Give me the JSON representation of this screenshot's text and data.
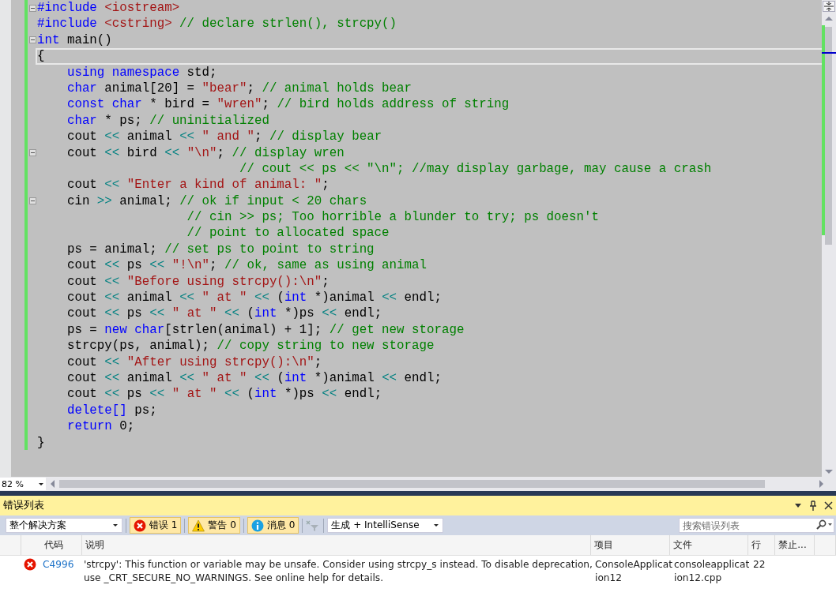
{
  "editor": {
    "lines": [
      {
        "fold": true,
        "current": false,
        "tokens": [
          {
            "kind": "keyword",
            "text": "#include"
          },
          {
            "kind": "string",
            "text": " <iostream>"
          }
        ]
      },
      {
        "fold": false,
        "current": false,
        "tokens": [
          {
            "kind": "keyword",
            "text": "#include"
          },
          {
            "kind": "string",
            "text": " <cstring>"
          },
          {
            "kind": "comment",
            "text": " // declare strlen(), strcpy()"
          }
        ]
      },
      {
        "fold": true,
        "current": false,
        "tokens": [
          {
            "kind": "keyword",
            "text": "int"
          },
          {
            "kind": "plain",
            "text": " main()"
          }
        ]
      },
      {
        "fold": false,
        "current": true,
        "tokens": [
          {
            "kind": "plain",
            "text": "{"
          }
        ]
      },
      {
        "fold": false,
        "current": false,
        "tokens": [
          {
            "kind": "keyword",
            "text": "    using namespace"
          },
          {
            "kind": "plain",
            "text": " std;"
          }
        ]
      },
      {
        "fold": false,
        "current": false,
        "tokens": [
          {
            "kind": "keyword",
            "text": "    char"
          },
          {
            "kind": "plain",
            "text": " animal[20] = "
          },
          {
            "kind": "string",
            "text": "\"bear\""
          },
          {
            "kind": "plain",
            "text": "; "
          },
          {
            "kind": "comment",
            "text": "// animal holds bear"
          }
        ]
      },
      {
        "fold": false,
        "current": false,
        "tokens": [
          {
            "kind": "keyword",
            "text": "    const char"
          },
          {
            "kind": "plain",
            "text": " * bird = "
          },
          {
            "kind": "string",
            "text": "\"wren\""
          },
          {
            "kind": "plain",
            "text": "; "
          },
          {
            "kind": "comment",
            "text": "// bird holds address of string"
          }
        ]
      },
      {
        "fold": false,
        "current": false,
        "tokens": [
          {
            "kind": "keyword",
            "text": "    char"
          },
          {
            "kind": "plain",
            "text": " * ps; "
          },
          {
            "kind": "comment",
            "text": "// uninitialized"
          }
        ]
      },
      {
        "fold": false,
        "current": false,
        "tokens": [
          {
            "kind": "plain",
            "text": "    cout "
          },
          {
            "kind": "operator",
            "text": "<<"
          },
          {
            "kind": "plain",
            "text": " animal "
          },
          {
            "kind": "operator",
            "text": "<<"
          },
          {
            "kind": "string",
            "text": " \" and \""
          },
          {
            "kind": "plain",
            "text": "; "
          },
          {
            "kind": "comment",
            "text": "// display bear"
          }
        ]
      },
      {
        "fold": true,
        "current": false,
        "tokens": [
          {
            "kind": "plain",
            "text": "    cout "
          },
          {
            "kind": "operator",
            "text": "<<"
          },
          {
            "kind": "plain",
            "text": " bird "
          },
          {
            "kind": "operator",
            "text": "<<"
          },
          {
            "kind": "string",
            "text": " \"\\n\""
          },
          {
            "kind": "plain",
            "text": "; "
          },
          {
            "kind": "comment",
            "text": "// display wren"
          }
        ]
      },
      {
        "fold": false,
        "current": false,
        "tokens": [
          {
            "kind": "comment",
            "text": "                           // cout << ps << \"\\n\"; //may display garbage, may cause a crash"
          }
        ]
      },
      {
        "fold": false,
        "current": false,
        "tokens": [
          {
            "kind": "plain",
            "text": "    cout "
          },
          {
            "kind": "operator",
            "text": "<<"
          },
          {
            "kind": "string",
            "text": " \"Enter a kind of animal: \""
          },
          {
            "kind": "plain",
            "text": ";"
          }
        ]
      },
      {
        "fold": true,
        "current": false,
        "tokens": [
          {
            "kind": "plain",
            "text": "    cin "
          },
          {
            "kind": "operator",
            "text": ">>"
          },
          {
            "kind": "plain",
            "text": " animal; "
          },
          {
            "kind": "comment",
            "text": "// ok if input < 20 chars"
          }
        ]
      },
      {
        "fold": false,
        "current": false,
        "tokens": [
          {
            "kind": "comment",
            "text": "                    // cin >> ps; Too horrible a blunder to try; ps doesn't"
          }
        ]
      },
      {
        "fold": false,
        "current": false,
        "tokens": [
          {
            "kind": "comment",
            "text": "                    // point to allocated space"
          }
        ]
      },
      {
        "fold": false,
        "current": false,
        "tokens": [
          {
            "kind": "plain",
            "text": "    ps = animal; "
          },
          {
            "kind": "comment",
            "text": "// set ps to point to string"
          }
        ]
      },
      {
        "fold": false,
        "current": false,
        "tokens": [
          {
            "kind": "plain",
            "text": "    cout "
          },
          {
            "kind": "operator",
            "text": "<<"
          },
          {
            "kind": "plain",
            "text": " ps "
          },
          {
            "kind": "operator",
            "text": "<<"
          },
          {
            "kind": "string",
            "text": " \"!\\n\""
          },
          {
            "kind": "plain",
            "text": "; "
          },
          {
            "kind": "comment",
            "text": "// ok, same as using animal"
          }
        ]
      },
      {
        "fold": false,
        "current": false,
        "tokens": [
          {
            "kind": "plain",
            "text": "    cout "
          },
          {
            "kind": "operator",
            "text": "<<"
          },
          {
            "kind": "string",
            "text": " \"Before using strcpy():\\n\""
          },
          {
            "kind": "plain",
            "text": ";"
          }
        ]
      },
      {
        "fold": false,
        "current": false,
        "tokens": [
          {
            "kind": "plain",
            "text": "    cout "
          },
          {
            "kind": "operator",
            "text": "<<"
          },
          {
            "kind": "plain",
            "text": " animal "
          },
          {
            "kind": "operator",
            "text": "<<"
          },
          {
            "kind": "string",
            "text": " \" at \""
          },
          {
            "kind": "operator",
            "text": " <<"
          },
          {
            "kind": "plain",
            "text": " ("
          },
          {
            "kind": "keyword",
            "text": "int"
          },
          {
            "kind": "plain",
            "text": " *)animal "
          },
          {
            "kind": "operator",
            "text": "<<"
          },
          {
            "kind": "plain",
            "text": " endl;"
          }
        ]
      },
      {
        "fold": false,
        "current": false,
        "tokens": [
          {
            "kind": "plain",
            "text": "    cout "
          },
          {
            "kind": "operator",
            "text": "<<"
          },
          {
            "kind": "plain",
            "text": " ps "
          },
          {
            "kind": "operator",
            "text": "<<"
          },
          {
            "kind": "string",
            "text": " \" at \""
          },
          {
            "kind": "operator",
            "text": " <<"
          },
          {
            "kind": "plain",
            "text": " ("
          },
          {
            "kind": "keyword",
            "text": "int"
          },
          {
            "kind": "plain",
            "text": " *)ps "
          },
          {
            "kind": "operator",
            "text": "<<"
          },
          {
            "kind": "plain",
            "text": " endl;"
          }
        ]
      },
      {
        "fold": false,
        "current": false,
        "tokens": [
          {
            "kind": "plain",
            "text": "    ps = "
          },
          {
            "kind": "keyword",
            "text": "new char"
          },
          {
            "kind": "plain",
            "text": "[strlen(animal) + 1]; "
          },
          {
            "kind": "comment",
            "text": "// get new storage"
          }
        ]
      },
      {
        "fold": false,
        "current": false,
        "tokens": [
          {
            "kind": "plain",
            "text": "    strcpy(ps, animal); "
          },
          {
            "kind": "comment",
            "text": "// copy string to new storage"
          }
        ]
      },
      {
        "fold": false,
        "current": false,
        "tokens": [
          {
            "kind": "plain",
            "text": "    cout "
          },
          {
            "kind": "operator",
            "text": "<<"
          },
          {
            "kind": "string",
            "text": " \"After using strcpy():\\n\""
          },
          {
            "kind": "plain",
            "text": ";"
          }
        ]
      },
      {
        "fold": false,
        "current": false,
        "tokens": [
          {
            "kind": "plain",
            "text": "    cout "
          },
          {
            "kind": "operator",
            "text": "<<"
          },
          {
            "kind": "plain",
            "text": " animal "
          },
          {
            "kind": "operator",
            "text": "<<"
          },
          {
            "kind": "string",
            "text": " \" at \""
          },
          {
            "kind": "operator",
            "text": " <<"
          },
          {
            "kind": "plain",
            "text": " ("
          },
          {
            "kind": "keyword",
            "text": "int"
          },
          {
            "kind": "plain",
            "text": " *)animal "
          },
          {
            "kind": "operator",
            "text": "<<"
          },
          {
            "kind": "plain",
            "text": " endl;"
          }
        ]
      },
      {
        "fold": false,
        "current": false,
        "tokens": [
          {
            "kind": "plain",
            "text": "    cout "
          },
          {
            "kind": "operator",
            "text": "<<"
          },
          {
            "kind": "plain",
            "text": " ps "
          },
          {
            "kind": "operator",
            "text": "<<"
          },
          {
            "kind": "string",
            "text": " \" at \""
          },
          {
            "kind": "operator",
            "text": " <<"
          },
          {
            "kind": "plain",
            "text": " ("
          },
          {
            "kind": "keyword",
            "text": "int"
          },
          {
            "kind": "plain",
            "text": " *)ps "
          },
          {
            "kind": "operator",
            "text": "<<"
          },
          {
            "kind": "plain",
            "text": " endl;"
          }
        ]
      },
      {
        "fold": false,
        "current": false,
        "tokens": [
          {
            "kind": "keyword",
            "text": "    delete[]"
          },
          {
            "kind": "plain",
            "text": " ps;"
          }
        ]
      },
      {
        "fold": false,
        "current": false,
        "tokens": [
          {
            "kind": "keyword",
            "text": "    return"
          },
          {
            "kind": "plain",
            "text": " 0;"
          }
        ]
      },
      {
        "fold": false,
        "current": false,
        "tokens": [
          {
            "kind": "plain",
            "text": "}"
          }
        ]
      }
    ],
    "zoom": "82 %"
  },
  "error_list": {
    "title": "错误列表",
    "scope": "整个解决方案",
    "filters": [
      {
        "kind": "error",
        "label": "错误 1",
        "selected": true
      },
      {
        "kind": "warning",
        "label": "警告 0",
        "selected": true
      },
      {
        "kind": "info",
        "label": "消息 0",
        "selected": true
      }
    ],
    "source": "生成 + IntelliSense",
    "search": {
      "placeholder": "搜索错误列表"
    },
    "columns": [
      "代码",
      "说明",
      "项目",
      "文件",
      "行",
      "禁止..."
    ],
    "rows": [
      {
        "kind": "error",
        "code": "C4996",
        "description": "'strcpy': This function or variable may be unsafe. Consider using strcpy_s instead. To disable deprecation, use _CRT_SECURE_NO_WARNINGS. See online help for details.",
        "project": "ConsoleApplication12",
        "file": "consoleapplication12.cpp",
        "line": "22"
      }
    ]
  }
}
